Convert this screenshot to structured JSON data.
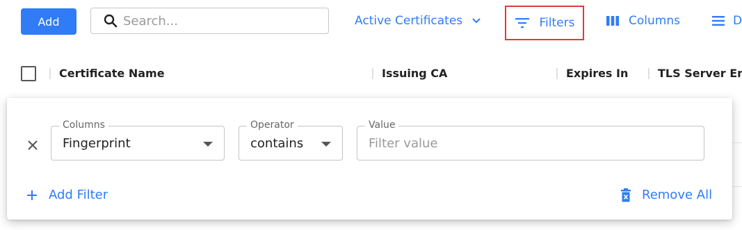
{
  "toolbar": {
    "add_label": "Add",
    "search_placeholder": "Search...",
    "view_label": "Active Certificates",
    "filters_label": "Filters",
    "columns_label": "Columns",
    "density_label": "D"
  },
  "table": {
    "columns": [
      "Certificate Name",
      "Issuing CA",
      "Expires In",
      "TLS Server End"
    ]
  },
  "filter_panel": {
    "columns_label": "Columns",
    "columns_value": "Fingerprint",
    "operator_label": "Operator",
    "operator_value": "contains",
    "value_label": "Value",
    "value_placeholder": "Filter value",
    "add_filter_label": "Add Filter",
    "remove_all_label": "Remove All"
  },
  "colors": {
    "accent": "#2f7cf6",
    "highlight_border": "#e53935"
  }
}
